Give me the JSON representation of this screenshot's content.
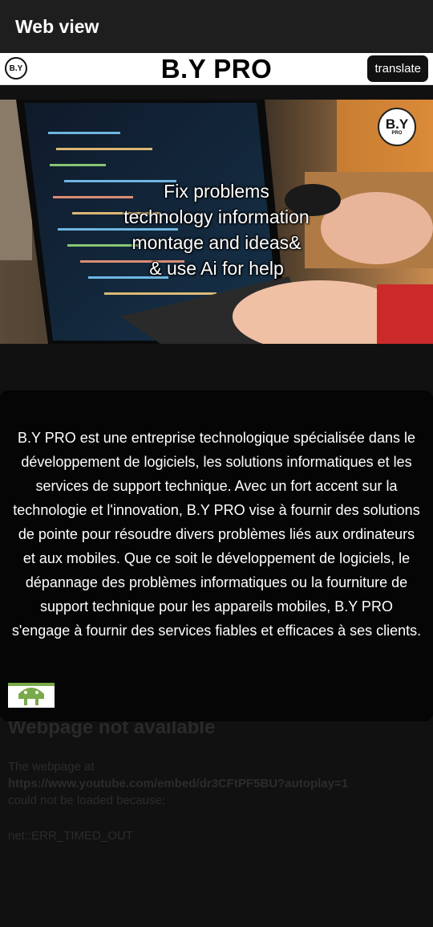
{
  "appbar": {
    "title": "Web view"
  },
  "header": {
    "logo_text": "B.Y",
    "brand": "B.Y PRO",
    "translate_label": "translate"
  },
  "hero": {
    "logo_text": "B.Y",
    "logo_sub": "PRO",
    "caption_lines": [
      "Fix problems",
      "technology information",
      "montage and ideas&",
      "& use Ai for help"
    ]
  },
  "about": {
    "text": "B.Y PRO est une entreprise technologique spécialisée dans le développement de logiciels, les solutions informatiques et les services de support technique. Avec un fort accent sur la technologie et l'innovation, B.Y PRO vise à fournir des solutions de pointe pour résoudre divers problèmes liés aux ordinateurs et aux mobiles. Que ce soit le développement de logiciels, le dépannage des problèmes informatiques ou la fourniture de support technique pour les appareils mobiles, B.Y PRO s'engage à fournir des services fiables et efficaces à ses clients."
  },
  "error_page": {
    "title": "Webpage not available",
    "line1": "The webpage at",
    "url": "https://www.youtube.com/embed/dr3CFtPF5BU?autoplay=1",
    "line2": "could not be loaded because:",
    "code": "net::ERR_TIMED_OUT"
  },
  "colors": {
    "appbar_bg": "#1e1e1e",
    "page_bg": "#111111",
    "header_bg": "#ffffff",
    "button_bg": "#111111"
  },
  "icons": {
    "android_badge": "android-icon"
  }
}
